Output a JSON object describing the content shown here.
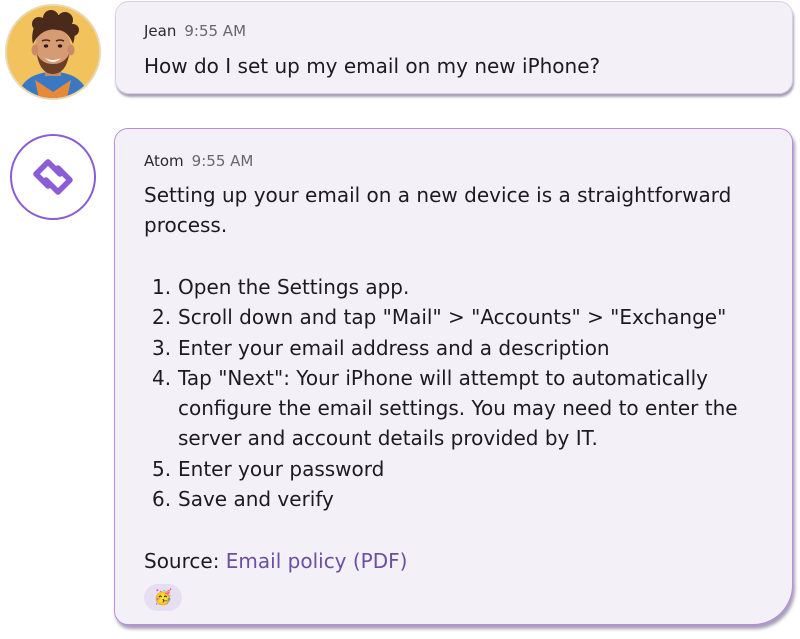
{
  "user_message": {
    "author": "Jean",
    "time": "9:55 AM",
    "text": "How do I set up my email on my new iPhone?"
  },
  "bot_message": {
    "author": "Atom",
    "time": "9:55 AM",
    "intro_line1": "Setting up your email on a new device is a straightforward",
    "intro_line2": "process.",
    "steps": [
      {
        "num": "1.",
        "lines": [
          "Open the Settings app."
        ]
      },
      {
        "num": "2.",
        "lines": [
          "Scroll down and tap \"Mail\" > \"Accounts\" > \"Exchange\""
        ]
      },
      {
        "num": "3.",
        "lines": [
          "Enter your email address and a description"
        ]
      },
      {
        "num": "4.",
        "lines": [
          "Tap \"Next\": Your iPhone will attempt to automatically",
          "configure the email settings. You may need to enter the",
          "server and account details provided by IT."
        ]
      },
      {
        "num": "5.",
        "lines": [
          "Enter your password"
        ]
      },
      {
        "num": "6.",
        "lines": [
          "Save and verify"
        ]
      }
    ],
    "source_label": "Source:",
    "source_link": "Email policy (PDF)",
    "reaction": "🥳"
  },
  "colors": {
    "accent": "#8a5cd6",
    "link": "#6b4fa3",
    "bubble": "#f3f1f7"
  },
  "icons": {
    "user_avatar": "person-photo",
    "bot_avatar": "atom-logo-icon"
  }
}
